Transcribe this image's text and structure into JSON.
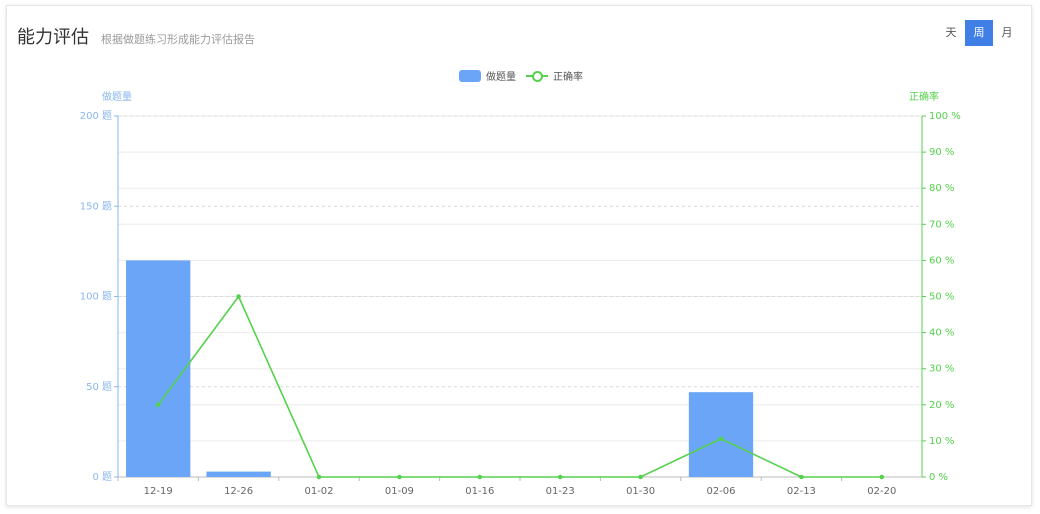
{
  "header": {
    "title": "能力评估",
    "subtitle": "根据做题练习形成能力评估报告"
  },
  "period_switch": [
    {
      "label": "天",
      "active": false
    },
    {
      "label": "周",
      "active": true
    },
    {
      "label": "月",
      "active": false
    }
  ],
  "colors": {
    "bar": "#6aa5f7",
    "line": "#55d14c",
    "left_axis": "#8ab6f0",
    "right_axis": "#55d14c",
    "active_button": "#3f7fe6"
  },
  "chart_data": {
    "type": "bar",
    "categories": [
      "12-19",
      "12-26",
      "01-02",
      "01-09",
      "01-16",
      "01-23",
      "01-30",
      "02-06",
      "02-13",
      "02-20"
    ],
    "series": [
      {
        "name": "做题量",
        "type": "bar",
        "axis": "left",
        "values": [
          120,
          3,
          0,
          0,
          0,
          0,
          0,
          47,
          0,
          0
        ]
      },
      {
        "name": "正确率",
        "type": "line",
        "axis": "right",
        "values": [
          20,
          50,
          0,
          0,
          0,
          0,
          0,
          10.6,
          0,
          0
        ]
      }
    ],
    "ylabel_left": "做题量",
    "ylabel_right": "正确率",
    "ylim_left": [
      0,
      200
    ],
    "ylim_right": [
      0,
      100
    ],
    "yticks_left": [
      "0 题",
      "50 题",
      "100 题",
      "150 题",
      "200 题"
    ],
    "yticks_right": [
      "0 %",
      "10 %",
      "20 %",
      "30 %",
      "40 %",
      "50 %",
      "60 %",
      "70 %",
      "80 %",
      "90 %",
      "100 %"
    ],
    "legend_position": "top-center",
    "grid": true
  }
}
